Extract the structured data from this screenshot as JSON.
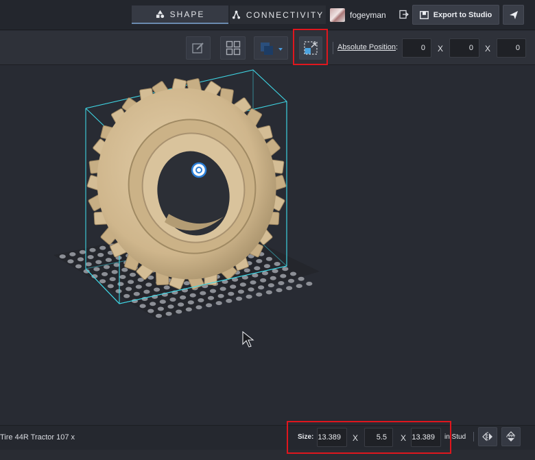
{
  "header": {
    "tabs": [
      {
        "label": "SHAPE",
        "icon": "shape-icon",
        "active": true
      },
      {
        "label": "CONNECTIVITY",
        "icon": "connectivity-icon",
        "active": false
      }
    ],
    "user": {
      "name": "fogeyman",
      "avatar": "avatar-image"
    },
    "export_label": "Export to Studio",
    "send_icon": "send-icon",
    "exit_icon": "exit-icon"
  },
  "toolbar": {
    "tools": [
      "edit-icon",
      "grid-icon",
      "color-icon",
      "resize-icon"
    ],
    "absolute_position_label": "Absolute Position",
    "position": {
      "x": "0",
      "y": "0",
      "z": "0"
    },
    "separator": "X"
  },
  "footer": {
    "part_name": "Tire  44R Tractor 107 x",
    "size_label": "Size:",
    "size": {
      "x": "13.389",
      "y": "5.5",
      "z": "13.389"
    },
    "separator": "X",
    "unit_label": "in Stud"
  },
  "colors": {
    "accent_tab": "#6b8bb0",
    "highlight_box": "#e0161d",
    "bounding_box": "#3fd6e4",
    "tire": "#d8c29c",
    "stud": "#8c8f96"
  }
}
